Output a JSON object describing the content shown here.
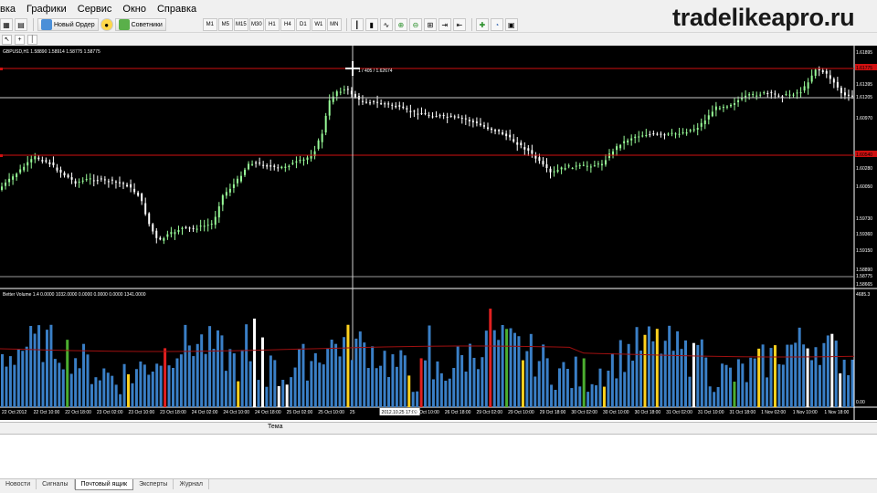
{
  "menu": [
    "вка",
    "Графики",
    "Сервис",
    "Окно",
    "Справка"
  ],
  "watermark": "tradelikeapro.ru",
  "toolbar": {
    "new_order": "Новый Ордер",
    "advisors": "Советники",
    "timeframes": [
      "M1",
      "M5",
      "M15",
      "M30",
      "H1",
      "H4",
      "D1",
      "W1",
      "MN"
    ]
  },
  "chart": {
    "header": "GBPUSD,H1  1.58890 1.58914 1.58775 1.58775",
    "crosshair_label": "1 / 405 / 1.62674",
    "price_scale": [
      "1.61895",
      "1.61775",
      "1.61395",
      "1.61205",
      "1.60970",
      "1.60540",
      "1.60280",
      "1.60050",
      "1.59730",
      "1.59360",
      "1.59150",
      "1.58890",
      "1.58775",
      "1.58665"
    ],
    "red_level_labels": [
      "1.61775",
      "1.60540"
    ],
    "line_level_label": "1.61205",
    "volume_header": "Better Volume 1.4  0.0000 1032.0000 0.0000 0.0000 0.0000 1341.0000",
    "volume_scale_top": "4685.3",
    "volume_scale_bottom": "0.00",
    "x_labels": [
      "22 Oct 2012",
      "22 Oct 10:00",
      "22 Oct 18:00",
      "23 Oct 02:00",
      "23 Oct 10:00",
      "23 Oct 18:00",
      "24 Oct 02:00",
      "24 Oct 10:00",
      "24 Oct 18:00",
      "25 Oct 02:00",
      "25 Oct 10:00",
      "25",
      "2012.10.25 17:00",
      "26 Oct 10:00",
      "26 Oct 18:00",
      "29 Oct 02:00",
      "29 Oct 10:00",
      "29 Oct 18:00",
      "30 Oct 02:00",
      "30 Oct 10:00",
      "30 Oct 18:00",
      "31 Oct 02:00",
      "31 Oct 10:00",
      "31 Oct 18:00",
      "1 Nov 02:00",
      "1 Nov 10:00",
      "1 Nov 18:00"
    ],
    "colors": {
      "background": "#000000",
      "bull_candle": "#98fb98",
      "bear_candle": "#ffffff",
      "level_line": "#d01010",
      "volume_blue": "#3a7fc6",
      "volume_red": "#e02020",
      "volume_white": "#ffffff",
      "volume_green": "#4caf30",
      "volume_yellow": "#ffd21f",
      "volume_ma": "#a01010"
    }
  },
  "terminal": {
    "header": "Тема",
    "tabs": [
      "Новости",
      "Сигналы",
      "Почтовый ящик",
      "Эксперты",
      "Журнал"
    ],
    "active_tab": "Почтовый ящик"
  }
}
